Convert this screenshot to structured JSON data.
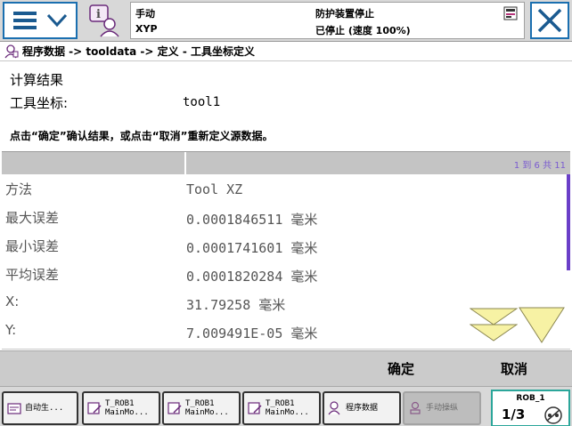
{
  "topbar": {
    "status_left_line1": "手动",
    "status_left_line2": "XYP",
    "status_right_line1": "防护装置停止",
    "status_right_line2": "已停止 (速度 100%)"
  },
  "breadcrumb": "程序数据 -> tooldata -> 定义 - 工具坐标定义",
  "result": {
    "title": "计算结果",
    "tool_label": "工具坐标:",
    "tool_value": "tool1",
    "instruction": "点击“确定”确认结果，或点击“取消”重新定义源数据。"
  },
  "table": {
    "page_indicator": "1 到 6 共 11",
    "rows": [
      {
        "name": "方法",
        "value": "Tool XZ"
      },
      {
        "name": "最大误差",
        "value": "0.0001846511 毫米"
      },
      {
        "name": "最小误差",
        "value": "0.0001741601 毫米"
      },
      {
        "name": "平均误差",
        "value": "0.0001820284 毫米"
      },
      {
        "name": "X:",
        "value": "31.79258 毫米"
      },
      {
        "name": "Y:",
        "value": "7.009491E-05 毫米"
      }
    ]
  },
  "actions": {
    "ok_label": "确定",
    "cancel_label": "取消"
  },
  "taskbar": {
    "items": [
      {
        "label": "自动生..."
      },
      {
        "label": "T_ROB1\nMainMo..."
      },
      {
        "label": "T_ROB1\nMainMo..."
      },
      {
        "label": "T_ROB1\nMainMo..."
      },
      {
        "label": "程序数据"
      },
      {
        "label": "手动操纵"
      }
    ],
    "robot_panel_title": "ROB_1",
    "robot_fraction": "1/3"
  },
  "colors": {
    "accent_blue": "#1a6fb0",
    "scroll_purple": "#6a3fc8",
    "arrow_yellow": "#f7f2a4",
    "rob_panel_teal": "#2ba69a"
  },
  "icons": [
    "menu-icon",
    "chevron-down-icon",
    "robot-info-icon",
    "close-icon",
    "program-data-icon",
    "scroll-up-icon",
    "scroll-down-icon",
    "task-icon",
    "robot-status-icon"
  ]
}
